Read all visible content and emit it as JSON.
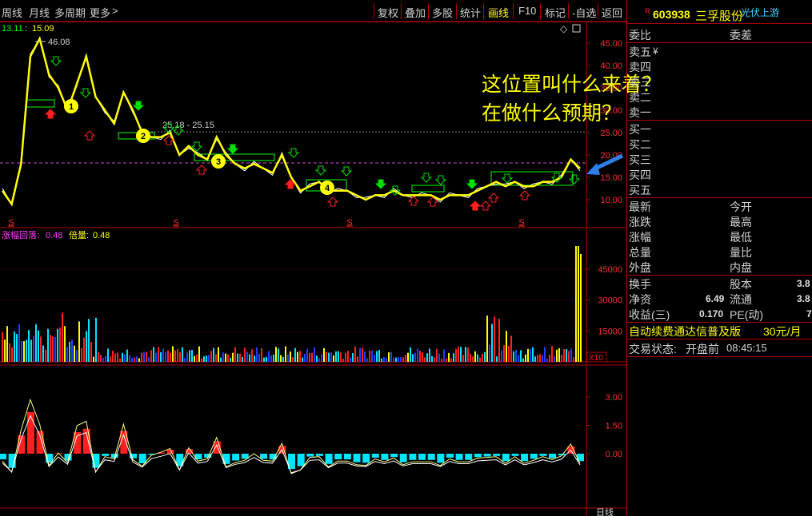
{
  "toolbar": {
    "left_items": [
      "周线",
      "月线",
      "多周期",
      "更多"
    ],
    "more_chevron": ">",
    "right_items": [
      "复权",
      "叠加",
      "多股",
      "统计",
      "画线",
      "F10",
      "标记",
      "-自选",
      "返回"
    ],
    "active_item": "画线"
  },
  "stock": {
    "marker": "R",
    "code": "603938",
    "name": "三孚股份",
    "sector": "光伏上游"
  },
  "price_chart": {
    "ma_label": "13.11",
    "ma_value": "15.09",
    "peak_label": "46.08",
    "line_label": "25.18 - 25.15",
    "y_ticks": [
      "45.00",
      "40.00",
      "35.00",
      "30.00",
      "25.00",
      "20.00",
      "15.00",
      "10.00"
    ],
    "badges": [
      "1",
      "2",
      "3",
      "4"
    ],
    "s_marker": "S",
    "series": {
      "name": "weekly close (approx)",
      "values": [
        12,
        9,
        18,
        42,
        46,
        38,
        35,
        30,
        36,
        42,
        33,
        30,
        27,
        34,
        30,
        25,
        24,
        24,
        25,
        20,
        22,
        20,
        19,
        24,
        20,
        18,
        17,
        18,
        17,
        16,
        20,
        15,
        12,
        13,
        14,
        12,
        12,
        12,
        11,
        10,
        11,
        11,
        12,
        11,
        11,
        11,
        11,
        10,
        11,
        11,
        11,
        12,
        13,
        14,
        13,
        14,
        13,
        13,
        14,
        14,
        15,
        19,
        17
      ]
    }
  },
  "volume_chart": {
    "indicator_label": "涨幅回落:",
    "indicator_value": "0.48",
    "ratio_label": "倍量:",
    "ratio_value": "0.48",
    "y_ticks": [
      "45000",
      "30000",
      "15000"
    ],
    "unit": "X10"
  },
  "macd_chart": {
    "y_ticks": [
      "3.00",
      "1.50",
      "0.00"
    ],
    "footer": "日线"
  },
  "question": {
    "line1": "这位置叫什么来着？",
    "line2": "在做什么预期？"
  },
  "order_book": {
    "header_left": "委比",
    "header_right": "委差",
    "sell_levels": [
      "卖五",
      "卖四",
      "卖三",
      "卖二",
      "卖一"
    ],
    "sell5_suffix": "¥",
    "buy_levels": [
      "买一",
      "买二",
      "买三",
      "买四",
      "买五"
    ]
  },
  "quote": {
    "left": [
      "最新",
      "涨跌",
      "涨幅",
      "总量",
      "外盘"
    ],
    "right": [
      "今开",
      "最高",
      "最低",
      "量比",
      "内盘"
    ]
  },
  "fundamentals": {
    "turnover_label": "换手",
    "capital_label": "股本",
    "capital_value": "3.8",
    "net_asset_label": "净资",
    "net_asset_value": "6.49",
    "float_label": "流通",
    "float_value": "3.8",
    "eps_label": "收益(三)",
    "eps_value": "0.170",
    "pe_label": "PE(动)",
    "pe_value": "7"
  },
  "subscription": {
    "text": "自动续费通达信普及版",
    "price": "30元/月"
  },
  "trade_status": {
    "label": "交易状态:",
    "status": "开盘前",
    "time": "08:45:15"
  },
  "colors": {
    "price_line": "#ffff00",
    "accent_red": "#ff2020",
    "macd_cyan": "#00e5ff",
    "border": "#b00000",
    "label_magenta": "#ff40ff"
  }
}
